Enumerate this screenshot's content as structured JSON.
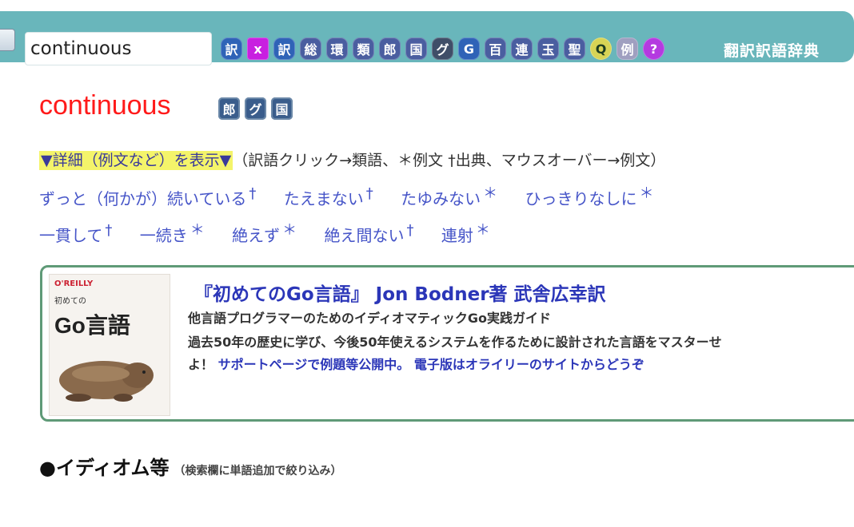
{
  "search": {
    "value": "continuous"
  },
  "toolbar": {
    "dict_buttons": [
      "訳",
      "x",
      "訳",
      "総",
      "環",
      "類",
      "郎",
      "国",
      "グ",
      "G",
      "百",
      "連",
      "玉",
      "聖",
      "Q",
      "例",
      "?"
    ],
    "title": "翻訳訳語辞典"
  },
  "entry": {
    "headword": "continuous",
    "badges": [
      "郎",
      "グ",
      "国"
    ]
  },
  "detail": {
    "toggle": "▼詳細（例文など）を表示▼",
    "hint": "（訳語クリック→類語、＊例文 †出典、マウスオーバー→例文）"
  },
  "translations": [
    {
      "text": "ずっと（何かが）続いている",
      "mark": "†"
    },
    {
      "text": "たえまない",
      "mark": "†"
    },
    {
      "text": "たゆみない",
      "mark": "＊"
    },
    {
      "text": "ひっきりなしに",
      "mark": "＊"
    },
    {
      "text": "一貫して",
      "mark": "†"
    },
    {
      "text": "一続き",
      "mark": "＊"
    },
    {
      "text": "絶えず",
      "mark": "＊"
    },
    {
      "text": "絶え間ない",
      "mark": "†"
    },
    {
      "text": "連射",
      "mark": "＊"
    }
  ],
  "ad": {
    "cover_brand": "O'REILLY",
    "cover_sub": "初めての",
    "cover_title": "Go言語",
    "title": "『初めてのGo言語』 Jon Bodner著 武舎広幸訳",
    "line1": "他言語プログラマーのためのイディオマティックGo実践ガイド",
    "line2": "過去50年の歴史に学び、今後50年使えるシステムを作るために設計された言語をマスターせ",
    "line3_prefix": "よ！",
    "link1": "サポートページで例題等公開中。",
    "link2": "電子版はオライリーのサイトからどうぞ"
  },
  "section": {
    "title": "●イディオム等",
    "note": "（検索欄に単語追加で絞り込み）"
  }
}
